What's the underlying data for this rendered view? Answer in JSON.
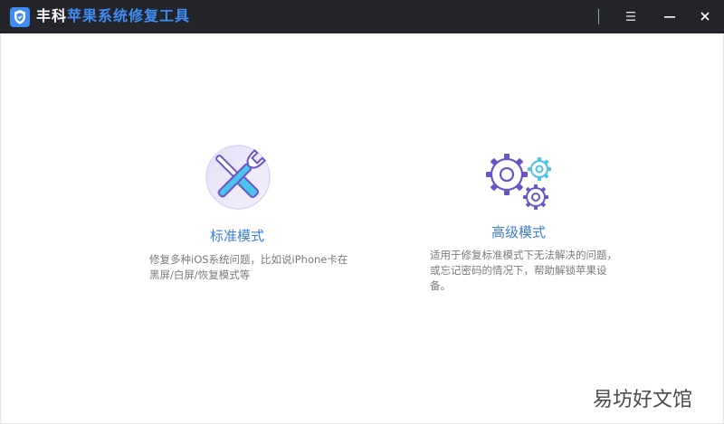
{
  "app": {
    "brand": "丰科",
    "product": "苹果系统修复工具",
    "logo_icon": "shield-icon",
    "accent": "#3f8df4",
    "titlebar_bg": "#23252b"
  },
  "window_controls": {
    "menu_icon": "menu-icon",
    "minimize_icon": "minimize-icon",
    "close_icon": "close-icon"
  },
  "modes": {
    "standard": {
      "icon": "wrench-screwdriver-icon",
      "title": "标准模式",
      "desc_line1": "修复多种iOS系统问题，比如说iPhone卡在",
      "desc_line2": "黑屏/白屏/恢复模式等"
    },
    "advanced": {
      "icon": "gears-icon",
      "title": "高级模式",
      "desc_line1": "适用于修复标准模式下无法解决的问题，",
      "desc_line2": "或忘记密码的情况下，帮助解锁苹果设",
      "desc_line3": "备。"
    }
  },
  "watermark": "易坊好文馆"
}
